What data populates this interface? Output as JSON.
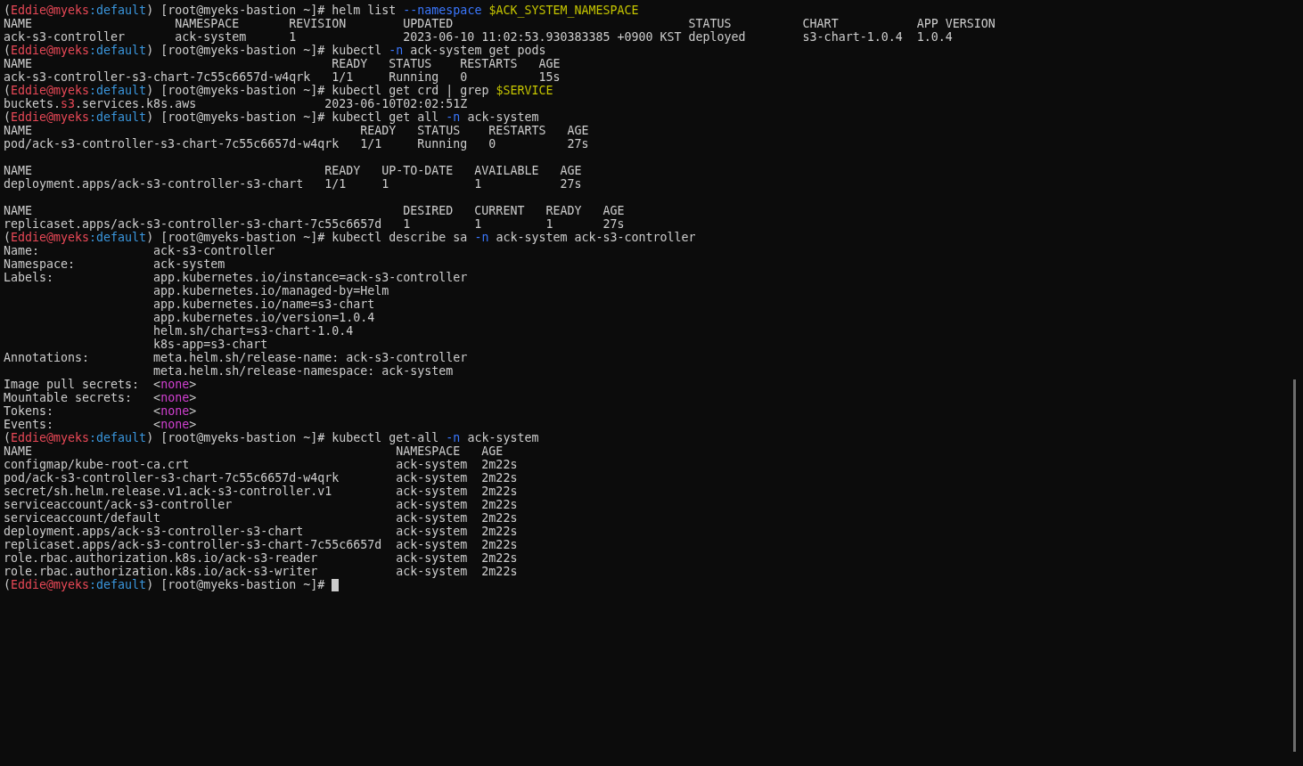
{
  "terminal": {
    "lines": [
      {
        "kind": "text",
        "segments": [
          {
            "kind": "plain",
            "text": "("
          },
          {
            "kind": "user",
            "text": "Eddie@myeks"
          },
          {
            "kind": "context",
            "text": ":default"
          },
          {
            "kind": "plain",
            "text": ") [root@myeks-bastion ~]# helm list "
          },
          {
            "kind": "flag",
            "text": "--namespace"
          },
          {
            "kind": "variable",
            "text": " $ACK_SYSTEM_NAMESPACE"
          }
        ]
      },
      {
        "kind": "text",
        "segments": [
          {
            "kind": "plain",
            "text": "NAME                    NAMESPACE       REVISION        UPDATED                                 STATUS          CHART           APP VERSION"
          }
        ]
      },
      {
        "kind": "text",
        "segments": [
          {
            "kind": "plain",
            "text": "ack-s3-controller       ack-system      1               2023-06-10 11:02:53.930383385 +0900 KST deployed        s3-chart-1.0.4  1.0.4"
          }
        ]
      },
      {
        "kind": "text",
        "segments": [
          {
            "kind": "plain",
            "text": "("
          },
          {
            "kind": "user",
            "text": "Eddie@myeks"
          },
          {
            "kind": "context",
            "text": ":default"
          },
          {
            "kind": "plain",
            "text": ") [root@myeks-bastion ~]# kubectl "
          },
          {
            "kind": "flag",
            "text": "-n"
          },
          {
            "kind": "plain",
            "text": " ack-system get pods"
          }
        ]
      },
      {
        "kind": "text",
        "segments": [
          {
            "kind": "plain",
            "text": "NAME                                          READY   STATUS    RESTARTS   AGE"
          }
        ]
      },
      {
        "kind": "text",
        "segments": [
          {
            "kind": "plain",
            "text": "ack-s3-controller-s3-chart-7c55c6657d-w4qrk   1/1     Running   0          15s"
          }
        ]
      },
      {
        "kind": "text",
        "segments": [
          {
            "kind": "plain",
            "text": "("
          },
          {
            "kind": "user",
            "text": "Eddie@myeks"
          },
          {
            "kind": "context",
            "text": ":default"
          },
          {
            "kind": "plain",
            "text": ") [root@myeks-bastion ~]# kubectl get crd | grep "
          },
          {
            "kind": "variable",
            "text": "$SERVICE"
          }
        ]
      },
      {
        "kind": "text",
        "segments": [
          {
            "kind": "plain",
            "text": "buckets."
          },
          {
            "kind": "match",
            "text": "s3"
          },
          {
            "kind": "plain",
            "text": ".services.k8s.aws                  2023-06-10T02:02:51Z"
          }
        ]
      },
      {
        "kind": "text",
        "segments": [
          {
            "kind": "plain",
            "text": "("
          },
          {
            "kind": "user",
            "text": "Eddie@myeks"
          },
          {
            "kind": "context",
            "text": ":default"
          },
          {
            "kind": "plain",
            "text": ") [root@myeks-bastion ~]# kubectl get all "
          },
          {
            "kind": "flag",
            "text": "-n"
          },
          {
            "kind": "plain",
            "text": " ack-system"
          }
        ]
      },
      {
        "kind": "text",
        "segments": [
          {
            "kind": "plain",
            "text": "NAME                                              READY   STATUS    RESTARTS   AGE"
          }
        ]
      },
      {
        "kind": "text",
        "segments": [
          {
            "kind": "plain",
            "text": "pod/ack-s3-controller-s3-chart-7c55c6657d-w4qrk   1/1     Running   0          27s"
          }
        ]
      },
      {
        "kind": "blank"
      },
      {
        "kind": "text",
        "segments": [
          {
            "kind": "plain",
            "text": "NAME                                         READY   UP-TO-DATE   AVAILABLE   AGE"
          }
        ]
      },
      {
        "kind": "text",
        "segments": [
          {
            "kind": "plain",
            "text": "deployment.apps/ack-s3-controller-s3-chart   1/1     1            1           27s"
          }
        ]
      },
      {
        "kind": "blank"
      },
      {
        "kind": "text",
        "segments": [
          {
            "kind": "plain",
            "text": "NAME                                                    DESIRED   CURRENT   READY   AGE"
          }
        ]
      },
      {
        "kind": "text",
        "segments": [
          {
            "kind": "plain",
            "text": "replicaset.apps/ack-s3-controller-s3-chart-7c55c6657d   1         1         1       27s"
          }
        ]
      },
      {
        "kind": "text",
        "segments": [
          {
            "kind": "plain",
            "text": "("
          },
          {
            "kind": "user",
            "text": "Eddie@myeks"
          },
          {
            "kind": "context",
            "text": ":default"
          },
          {
            "kind": "plain",
            "text": ") [root@myeks-bastion ~]# kubectl describe sa "
          },
          {
            "kind": "flag",
            "text": "-n"
          },
          {
            "kind": "plain",
            "text": " ack-system ack-s3-controller"
          }
        ]
      },
      {
        "kind": "text",
        "segments": [
          {
            "kind": "plain",
            "text": "Name:                ack-s3-controller"
          }
        ]
      },
      {
        "kind": "text",
        "segments": [
          {
            "kind": "plain",
            "text": "Namespace:           ack-system"
          }
        ]
      },
      {
        "kind": "text",
        "segments": [
          {
            "kind": "plain",
            "text": "Labels:              app.kubernetes.io/instance=ack-s3-controller"
          }
        ]
      },
      {
        "kind": "text",
        "segments": [
          {
            "kind": "plain",
            "text": "                     app.kubernetes.io/managed-by=Helm"
          }
        ]
      },
      {
        "kind": "text",
        "segments": [
          {
            "kind": "plain",
            "text": "                     app.kubernetes.io/name=s3-chart"
          }
        ]
      },
      {
        "kind": "text",
        "segments": [
          {
            "kind": "plain",
            "text": "                     app.kubernetes.io/version=1.0.4"
          }
        ]
      },
      {
        "kind": "text",
        "segments": [
          {
            "kind": "plain",
            "text": "                     helm.sh/chart=s3-chart-1.0.4"
          }
        ]
      },
      {
        "kind": "text",
        "segments": [
          {
            "kind": "plain",
            "text": "                     k8s-app=s3-chart"
          }
        ]
      },
      {
        "kind": "text",
        "segments": [
          {
            "kind": "plain",
            "text": "Annotations:         meta.helm.sh/release-name: ack-s3-controller"
          }
        ]
      },
      {
        "kind": "text",
        "segments": [
          {
            "kind": "plain",
            "text": "                     meta.helm.sh/release-namespace: ack-system"
          }
        ]
      },
      {
        "kind": "text",
        "segments": [
          {
            "kind": "plain",
            "text": "Image pull secrets:  <"
          },
          {
            "kind": "none",
            "text": "none"
          },
          {
            "kind": "plain",
            "text": ">"
          }
        ]
      },
      {
        "kind": "text",
        "segments": [
          {
            "kind": "plain",
            "text": "Mountable secrets:   <"
          },
          {
            "kind": "none",
            "text": "none"
          },
          {
            "kind": "plain",
            "text": ">"
          }
        ]
      },
      {
        "kind": "text",
        "segments": [
          {
            "kind": "plain",
            "text": "Tokens:              <"
          },
          {
            "kind": "none",
            "text": "none"
          },
          {
            "kind": "plain",
            "text": ">"
          }
        ]
      },
      {
        "kind": "text",
        "segments": [
          {
            "kind": "plain",
            "text": "Events:              <"
          },
          {
            "kind": "none",
            "text": "none"
          },
          {
            "kind": "plain",
            "text": ">"
          }
        ]
      },
      {
        "kind": "text",
        "segments": [
          {
            "kind": "plain",
            "text": "("
          },
          {
            "kind": "user",
            "text": "Eddie@myeks"
          },
          {
            "kind": "context",
            "text": ":default"
          },
          {
            "kind": "plain",
            "text": ") [root@myeks-bastion ~]# kubectl get-all "
          },
          {
            "kind": "flag",
            "text": "-n"
          },
          {
            "kind": "plain",
            "text": " ack-system"
          }
        ]
      },
      {
        "kind": "text",
        "segments": [
          {
            "kind": "plain",
            "text": "NAME                                                   NAMESPACE   AGE"
          }
        ]
      },
      {
        "kind": "text",
        "segments": [
          {
            "kind": "plain",
            "text": "configmap/kube-root-ca.crt                             ack-system  2m22s"
          }
        ]
      },
      {
        "kind": "text",
        "segments": [
          {
            "kind": "plain",
            "text": "pod/ack-s3-controller-s3-chart-7c55c6657d-w4qrk        ack-system  2m22s"
          }
        ]
      },
      {
        "kind": "text",
        "segments": [
          {
            "kind": "plain",
            "text": "secret/sh.helm.release.v1.ack-s3-controller.v1         ack-system  2m22s"
          }
        ]
      },
      {
        "kind": "text",
        "segments": [
          {
            "kind": "plain",
            "text": "serviceaccount/ack-s3-controller                       ack-system  2m22s"
          }
        ]
      },
      {
        "kind": "text",
        "segments": [
          {
            "kind": "plain",
            "text": "serviceaccount/default                                 ack-system  2m22s"
          }
        ]
      },
      {
        "kind": "text",
        "segments": [
          {
            "kind": "plain",
            "text": "deployment.apps/ack-s3-controller-s3-chart             ack-system  2m22s"
          }
        ]
      },
      {
        "kind": "text",
        "segments": [
          {
            "kind": "plain",
            "text": "replicaset.apps/ack-s3-controller-s3-chart-7c55c6657d  ack-system  2m22s"
          }
        ]
      },
      {
        "kind": "text",
        "segments": [
          {
            "kind": "plain",
            "text": "role.rbac.authorization.k8s.io/ack-s3-reader           ack-system  2m22s"
          }
        ]
      },
      {
        "kind": "text",
        "segments": [
          {
            "kind": "plain",
            "text": "role.rbac.authorization.k8s.io/ack-s3-writer           ack-system  2m22s"
          }
        ]
      }
    ],
    "input_line": {
      "segments": [
        {
          "kind": "plain",
          "text": "("
        },
        {
          "kind": "user",
          "text": "Eddie@myeks"
        },
        {
          "kind": "context",
          "text": ":default"
        },
        {
          "kind": "plain",
          "text": ") [root@myeks-bastion ~]#"
        }
      ],
      "cursor": true
    }
  }
}
